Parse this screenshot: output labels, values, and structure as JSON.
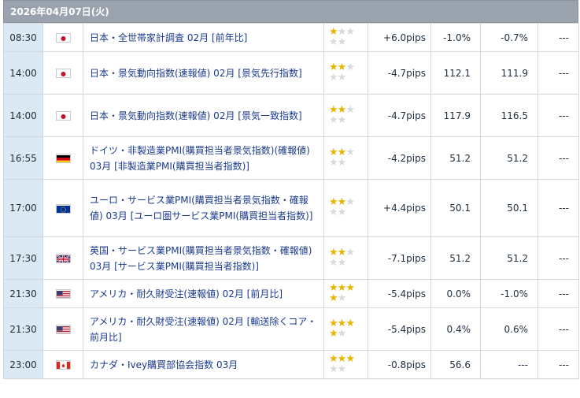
{
  "date_header": "2026年04月07日(火)",
  "colors": {
    "header_bg": "#9aa3ad",
    "time_bg": "#dbe9f5",
    "event_text": "#1a3a8f",
    "star_on": "#e9b400",
    "star_off": "#d6d9dd"
  },
  "rows": [
    {
      "time": "08:30",
      "flag": "jp-flag-icon",
      "event": "日本・全世帯家計調査 02月 [前年比]",
      "stars": 1,
      "pips": "+6.0pips",
      "result": "-1.0%",
      "forecast": "-0.7%",
      "prev": "---",
      "h": 36
    },
    {
      "time": "14:00",
      "flag": "jp-flag-icon",
      "event": "日本・景気動向指数(速報値) 02月 [景気先行指数]",
      "stars": 2,
      "pips": "-4.7pips",
      "result": "112.1",
      "forecast": "111.9",
      "prev": "---",
      "h": 54
    },
    {
      "time": "14:00",
      "flag": "jp-flag-icon",
      "event": "日本・景気動向指数(速報値) 02月 [景気一致指数]",
      "stars": 2,
      "pips": "-4.7pips",
      "result": "117.9",
      "forecast": "116.5",
      "prev": "---",
      "h": 54
    },
    {
      "time": "16:55",
      "flag": "de-flag-icon",
      "event": "ドイツ・非製造業PMI(購買担当者景気指数)(確報値) 03月 [非製造業PMI(購買担当者指数)]",
      "stars": 2,
      "pips": "-4.2pips",
      "result": "51.2",
      "forecast": "51.2",
      "prev": "---",
      "h": 54
    },
    {
      "time": "17:00",
      "flag": "eu-flag-icon",
      "event": "ユーロ・サービス業PMI(購買担当者景気指数・確報値) 03月 [ユーロ圏サービス業PMI(購買担当者指数)]",
      "stars": 2,
      "pips": "+4.4pips",
      "result": "50.1",
      "forecast": "50.1",
      "prev": "---",
      "h": 73
    },
    {
      "time": "17:30",
      "flag": "gb-flag-icon",
      "event": "英国・サービス業PMI(購買担当者景気指数・確報値) 03月 [サービス業PMI(購買担当者指数)]",
      "stars": 2,
      "pips": "-7.1pips",
      "result": "51.2",
      "forecast": "51.2",
      "prev": "---",
      "h": 54
    },
    {
      "time": "21:30",
      "flag": "us-flag-icon",
      "event": "アメリカ・耐久財受注(速報値) 02月 [前月比]",
      "stars": 4,
      "pips": "-5.4pips",
      "result": "0.0%",
      "forecast": "-1.0%",
      "prev": "---",
      "h": 36
    },
    {
      "time": "21:30",
      "flag": "us-flag-icon",
      "event": "アメリカ・耐久財受注(速報値) 02月 [輸送除くコア・前月比]",
      "stars": 4,
      "pips": "-5.4pips",
      "result": "0.4%",
      "forecast": "0.6%",
      "prev": "---",
      "h": 54
    },
    {
      "time": "23:00",
      "flag": "ca-flag-icon",
      "event": "カナダ・Ivey購買部協会指数 03月",
      "stars": 3,
      "pips": "-0.8pips",
      "result": "56.6",
      "forecast": "---",
      "prev": "---",
      "h": 36
    }
  ]
}
